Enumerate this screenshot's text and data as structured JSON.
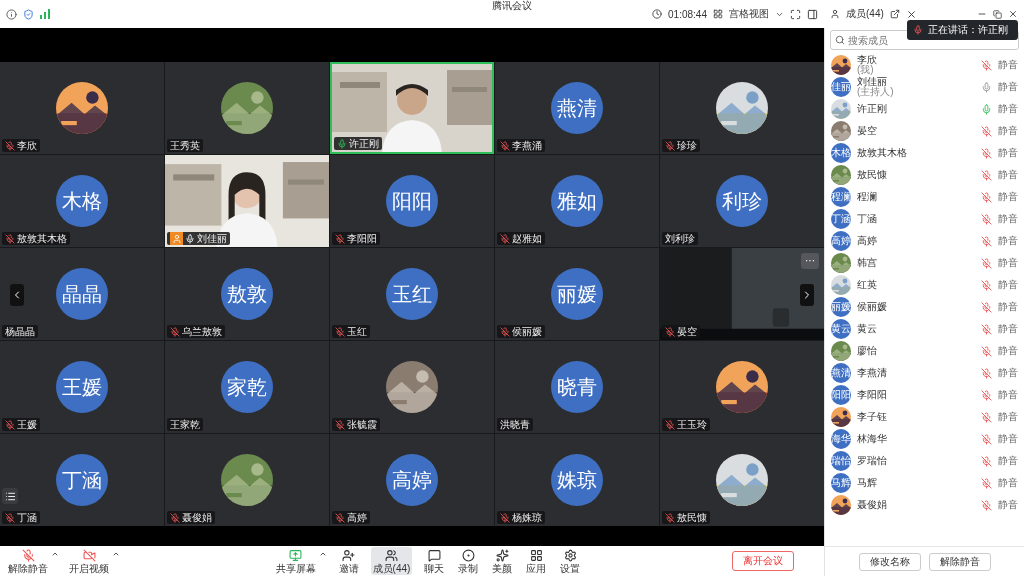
{
  "window": {
    "title": "腾讯会议"
  },
  "top_bar": {
    "timer": "01:08:44",
    "view": "宫格视图",
    "members_tab": "成员(44)"
  },
  "toast": "正在讲话：许正刚",
  "tiles": [
    {
      "name": "李欣",
      "active": false,
      "mic": {
        "muted": true,
        "speaking": false
      }
    },
    {
      "name": "王秀英",
      "active": false
    },
    {
      "name": "许正刚",
      "kind": "video",
      "active": true,
      "mic": {
        "muted": false,
        "speaking": true
      }
    },
    {
      "name": "李燕涌",
      "kind": "avatar",
      "avatar_text": "燕清",
      "active": false,
      "mic": {
        "muted": true,
        "speaking": false
      }
    },
    {
      "name": "珍珍",
      "active": false,
      "mic": {
        "muted": true,
        "speaking": false
      }
    },
    {
      "name": "敖敦其木格",
      "kind": "avatar",
      "avatar_text": "木格",
      "active": false,
      "mic": {
        "muted": true,
        "speaking": false
      }
    },
    {
      "name": "刘佳丽",
      "kind": "video",
      "active": false,
      "host": true,
      "mic": {
        "muted": false,
        "speaking": false
      }
    },
    {
      "name": "李阳阳",
      "kind": "avatar",
      "avatar_text": "阳阳",
      "active": false,
      "mic": {
        "muted": true,
        "speaking": false
      }
    },
    {
      "name": "赵雅如",
      "kind": "avatar",
      "avatar_text": "雅如",
      "active": false,
      "mic": {
        "muted": true,
        "speaking": false
      }
    },
    {
      "name": "刘利珍",
      "kind": "avatar",
      "avatar_text": "利珍",
      "active": false
    },
    {
      "name": "杨晶晶",
      "kind": "avatar",
      "avatar_text": "晶晶",
      "active": false
    },
    {
      "name": "乌兰敖敦",
      "kind": "avatar",
      "avatar_text": "敖敦",
      "active": false,
      "mic": {
        "muted": true,
        "speaking": false
      }
    },
    {
      "name": "玉红",
      "kind": "avatar",
      "avatar_text": "玉红",
      "active": false,
      "mic": {
        "muted": true,
        "speaking": false
      }
    },
    {
      "name": "侯丽媛",
      "kind": "avatar",
      "avatar_text": "丽媛",
      "active": false,
      "mic": {
        "muted": true,
        "speaking": false
      }
    },
    {
      "name": "晏空",
      "kind": "video",
      "active": false,
      "more": "···",
      "mic": {
        "muted": true,
        "speaking": false
      }
    },
    {
      "name": "王媛",
      "kind": "avatar",
      "avatar_text": "王媛",
      "active": false,
      "mic": {
        "muted": true,
        "speaking": false
      }
    },
    {
      "name": "王家乾",
      "kind": "avatar",
      "avatar_text": "家乾",
      "active": false
    },
    {
      "name": "张毓霞",
      "active": false,
      "mic": {
        "muted": true,
        "speaking": false
      }
    },
    {
      "name": "洪晓青",
      "kind": "avatar",
      "avatar_text": "晓青",
      "active": false
    },
    {
      "name": "王玉玲",
      "active": false,
      "mic": {
        "muted": true,
        "speaking": false
      }
    },
    {
      "name": "丁涵",
      "kind": "avatar",
      "avatar_text": "丁涵",
      "active": false,
      "mic": {
        "muted": true,
        "speaking": false
      }
    },
    {
      "name": "聂俊娟",
      "active": false,
      "mic": {
        "muted": true,
        "speaking": false
      }
    },
    {
      "name": "高婷",
      "kind": "avatar",
      "avatar_text": "高婷",
      "active": false,
      "mic": {
        "muted": true,
        "speaking": false
      }
    },
    {
      "name": "杨姝琼",
      "kind": "avatar",
      "avatar_text": "姝琼",
      "active": false,
      "mic": {
        "muted": true,
        "speaking": false
      }
    },
    {
      "name": "敖民慷",
      "active": false,
      "mic": {
        "muted": true,
        "speaking": false
      }
    }
  ],
  "search": {
    "placeholder": "搜索成员"
  },
  "members": [
    {
      "name": "李欣",
      "note": "(我)",
      "muted": true,
      "speaking": false,
      "action": "静音"
    },
    {
      "name": "刘佳丽",
      "note": "(主持人)",
      "kind": "avatar",
      "avatar_text": "佳丽",
      "muted": false,
      "speaking": false,
      "action": "静音"
    },
    {
      "name": "许正刚",
      "muted": false,
      "speaking": true,
      "action": "静音"
    },
    {
      "name": "晏空",
      "muted": true,
      "speaking": false,
      "action": "静音"
    },
    {
      "name": "敖敦其木格",
      "kind": "avatar",
      "avatar_text": "木格",
      "muted": true,
      "speaking": false,
      "action": "静音"
    },
    {
      "name": "敖民慷",
      "muted": true,
      "speaking": false,
      "action": "静音"
    },
    {
      "name": "程澜",
      "kind": "avatar",
      "avatar_text": "程澜",
      "muted": true,
      "speaking": false,
      "action": "静音"
    },
    {
      "name": "丁涵",
      "kind": "avatar",
      "avatar_text": "丁涵",
      "muted": true,
      "speaking": false,
      "action": "静音"
    },
    {
      "name": "高婷",
      "kind": "avatar",
      "avatar_text": "高婷",
      "muted": true,
      "speaking": false,
      "action": "静音"
    },
    {
      "name": "韩宫",
      "muted": true,
      "speaking": false,
      "action": "静音"
    },
    {
      "name": "红英",
      "muted": true,
      "speaking": false,
      "action": "静音"
    },
    {
      "name": "侯丽媛",
      "kind": "avatar",
      "avatar_text": "丽媛",
      "muted": true,
      "speaking": false,
      "action": "静音"
    },
    {
      "name": "黄云",
      "kind": "avatar",
      "avatar_text": "黄云",
      "muted": true,
      "speaking": false,
      "action": "静音"
    },
    {
      "name": "廖怡",
      "muted": true,
      "speaking": false,
      "action": "静音"
    },
    {
      "name": "李燕清",
      "kind": "avatar",
      "avatar_text": "燕清",
      "muted": true,
      "speaking": false,
      "action": "静音"
    },
    {
      "name": "李阳阳",
      "kind": "avatar",
      "avatar_text": "阳阳",
      "muted": true,
      "speaking": false,
      "action": "静音"
    },
    {
      "name": "李子钰",
      "muted": true,
      "speaking": false,
      "action": "静音"
    },
    {
      "name": "林海华",
      "kind": "avatar",
      "avatar_text": "海华",
      "muted": true,
      "speaking": false,
      "action": "静音"
    },
    {
      "name": "罗瑞怡",
      "kind": "avatar",
      "avatar_text": "瑞怡",
      "muted": true,
      "speaking": false,
      "action": "静音"
    },
    {
      "name": "马辉",
      "kind": "avatar",
      "avatar_text": "马辉",
      "muted": true,
      "speaking": false,
      "action": "静音"
    },
    {
      "name": "聂俊娟",
      "muted": true,
      "speaking": false,
      "action": "静音"
    }
  ],
  "panel_buttons": [
    "修改名称",
    "解除静音"
  ],
  "toolbar": {
    "media": [
      {
        "label": "解除静音",
        "caret": true
      },
      {
        "label": "开启视频",
        "caret": true
      }
    ],
    "tools": [
      {
        "label": "共享屏幕",
        "selected": false,
        "caret": true
      },
      {
        "label": "邀请",
        "selected": false,
        "caret": false
      },
      {
        "label": "成员(44)",
        "selected": true,
        "caret": false
      },
      {
        "label": "聊天",
        "selected": false,
        "caret": false
      },
      {
        "label": "录制",
        "selected": false,
        "caret": false
      },
      {
        "label": "美颜",
        "selected": false,
        "caret": false
      },
      {
        "label": "应用",
        "selected": false,
        "caret": false
      },
      {
        "label": "设置",
        "selected": false,
        "caret": false
      }
    ],
    "leave": "离开会议"
  }
}
